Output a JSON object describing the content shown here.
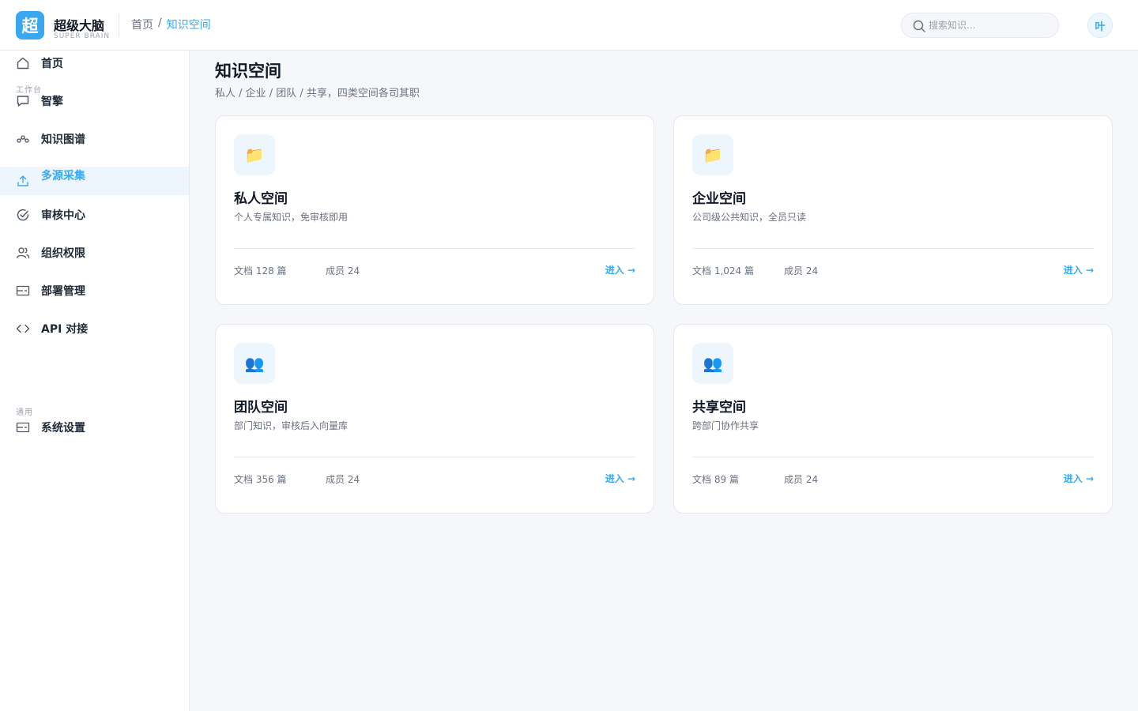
{
  "brand": {
    "logo_char": "超",
    "name": "超级大脑",
    "sub": "SUPER BRAIN"
  },
  "breadcrumb": {
    "home": "首页",
    "sep": "/",
    "current": "知识空间"
  },
  "search": {
    "placeholder": "搜索知识..."
  },
  "user": {
    "avatar": "叶"
  },
  "sidebar": {
    "items": [
      {
        "label": "首页",
        "icon": "home-icon"
      },
      {
        "label": "智擎",
        "icon": "chat-icon"
      },
      {
        "label": "知识图谱",
        "icon": "graph-icon"
      },
      {
        "label": "多源采集",
        "icon": "upload-icon",
        "active": true
      },
      {
        "label": "审核中心",
        "icon": "check-circle-icon"
      },
      {
        "label": "组织权限",
        "icon": "users-icon"
      },
      {
        "label": "部署管理",
        "icon": "deploy-icon"
      },
      {
        "label": "API 对接",
        "icon": "code-icon"
      },
      {
        "label": "系统设置",
        "icon": "settings-icon"
      }
    ],
    "section_workspace": "工作台",
    "section_general": "通用"
  },
  "main": {
    "title": "知识空间",
    "subtitle": "私人 / 企业 / 团队 / 共享，四类空间各司其职"
  },
  "cards": [
    {
      "icon": "📁",
      "icon_name": "folder-icon",
      "title": "私人空间",
      "desc": "个人专属知识，免审核即用",
      "docs": "文档 128 篇",
      "members": "成员 24",
      "enter": "进入 →"
    },
    {
      "icon": "📁",
      "icon_name": "folder-icon",
      "title": "企业空间",
      "desc": "公司级公共知识，全员只读",
      "docs": "文档 1,024 篇",
      "members": "成员 24",
      "enter": "进入 →"
    },
    {
      "icon": "👥",
      "icon_name": "team-icon",
      "title": "团队空间",
      "desc": "部门知识，审核后入向量库",
      "docs": "文档 356 篇",
      "members": "成员 24",
      "enter": "进入 →"
    },
    {
      "icon": "👥",
      "icon_name": "team-icon",
      "title": "共享空间",
      "desc": "跨部门协作共享",
      "docs": "文档 89 篇",
      "members": "成员 24",
      "enter": "进入 →"
    }
  ],
  "colors": {
    "accent": "#3aa8f0",
    "active_bg": "#eef6fd"
  }
}
